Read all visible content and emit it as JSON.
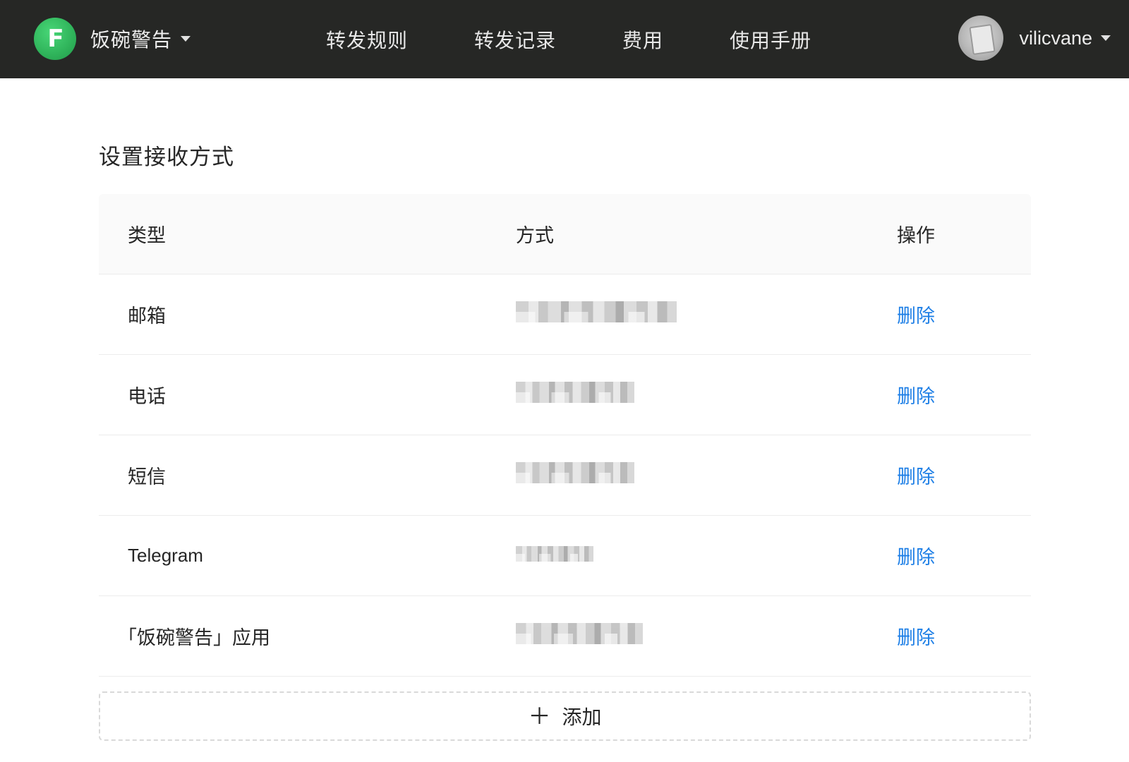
{
  "nav": {
    "brand_initial": "F",
    "brand_name": "饭碗警告",
    "items": [
      {
        "label": "转发规则"
      },
      {
        "label": "转发记录"
      },
      {
        "label": "费用"
      },
      {
        "label": "使用手册"
      }
    ],
    "username": "vilicvane"
  },
  "page": {
    "title": "设置接收方式"
  },
  "table": {
    "headers": {
      "type": "类型",
      "method": "方式",
      "action": "操作"
    },
    "rows": [
      {
        "type": "邮箱",
        "method": "",
        "action": "删除"
      },
      {
        "type": "电话",
        "method": "",
        "action": "删除"
      },
      {
        "type": "短信",
        "method": "",
        "action": "删除"
      },
      {
        "type": "Telegram",
        "method": "",
        "action": "删除"
      },
      {
        "type": "「饭碗警告」应用",
        "method": "",
        "action": "删除"
      }
    ]
  },
  "add_button": {
    "icon": "plus-icon",
    "label": "添加"
  },
  "colors": {
    "topbar": "#262725",
    "brand_green": "#2fb35a",
    "link_blue": "#1e7fe6",
    "header_bg": "#fafafa"
  }
}
